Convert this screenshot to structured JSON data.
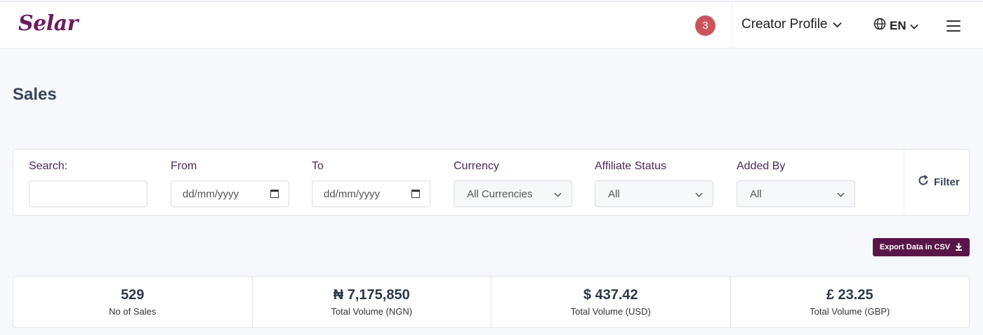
{
  "header": {
    "logo_text": "Selar",
    "notification_count": "3",
    "profile_label": "Creator Profile",
    "language": "EN"
  },
  "page": {
    "title": "Sales"
  },
  "filters": {
    "search_label": "Search:",
    "from_label": "From",
    "from_placeholder": "dd/mm/yyyy",
    "to_label": "To",
    "to_placeholder": "dd/mm/yyyy",
    "currency_label": "Currency",
    "currency_value": "All Currencies",
    "affiliate_label": "Affiliate Status",
    "affiliate_value": "All",
    "added_by_label": "Added By",
    "added_by_value": "All",
    "filter_button": "Filter"
  },
  "export": {
    "label": "Export Data in CSV"
  },
  "stats": [
    {
      "value": "529",
      "label": "No of Sales"
    },
    {
      "value": "₦ 7,175,850",
      "label": "Total Volume (NGN)"
    },
    {
      "value": "$ 437.42",
      "label": "Total Volume (USD)"
    },
    {
      "value": "£ 23.25",
      "label": "Total Volume (GBP)"
    }
  ],
  "colors": {
    "brand": "#6b1d5c",
    "export_button": "#5a1548",
    "badge": "#c9545c",
    "background": "#f6f8fc"
  },
  "icons": [
    "chevron-down-icon",
    "globe-icon",
    "menu-icon",
    "calendar-icon",
    "refresh-icon",
    "download-icon"
  ]
}
